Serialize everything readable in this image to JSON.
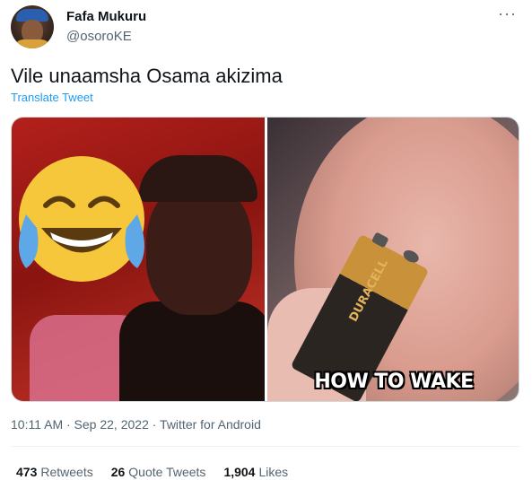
{
  "author": {
    "name": "Fafa Mukuru",
    "handle": "@osoroKE",
    "more_icon": "more-horizontal-icon"
  },
  "tweet": {
    "text": "Vile unaamsha Osama akizima",
    "translate_label": "Translate Tweet"
  },
  "media": {
    "right_image": {
      "battery_label": "DURACELL",
      "caption": "HOW TO WAKE"
    }
  },
  "meta": {
    "text": "10:11 AM · Sep 22, 2022 · Twitter for Android"
  },
  "stats": {
    "retweets_count": "473",
    "retweets_label": "Retweets",
    "quotes_count": "26",
    "quotes_label": "Quote Tweets",
    "likes_count": "1,904",
    "likes_label": "Likes"
  },
  "colors": {
    "link": "#1d9bf0",
    "secondary_text": "#536471",
    "primary_text": "#0f1419"
  }
}
